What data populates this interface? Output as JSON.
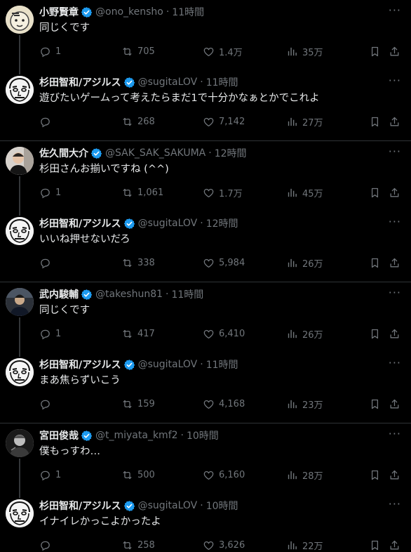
{
  "threads": [
    {
      "tweets": [
        {
          "name": "小野賢章",
          "handle": "@ono_kensho",
          "time": "11時間",
          "text": "同じくです",
          "replies": "1",
          "retweets": "705",
          "likes": "1.4万",
          "views": "35万",
          "avatar": "avatar-ono"
        },
        {
          "name": "杉田智和/アジルス",
          "handle": "@sugitaLOV",
          "time": "11時間",
          "text": "遊びたいゲームって考えたらまだ1で十分かなぁとかでこれよ",
          "replies": "",
          "retweets": "268",
          "likes": "7,142",
          "views": "27万",
          "avatar": "avatar-sugita"
        }
      ]
    },
    {
      "tweets": [
        {
          "name": "佐久間大介",
          "handle": "@SAK_SAK_SAKUMA",
          "time": "12時間",
          "text": "杉田さんお揃いですね (^^)",
          "replies": "1",
          "retweets": "1,061",
          "likes": "1.7万",
          "views": "45万",
          "avatar": "avatar-sakuma"
        },
        {
          "name": "杉田智和/アジルス",
          "handle": "@sugitaLOV",
          "time": "12時間",
          "text": "いいね押せないだろ",
          "replies": "",
          "retweets": "338",
          "likes": "5,984",
          "views": "26万",
          "avatar": "avatar-sugita"
        }
      ]
    },
    {
      "tweets": [
        {
          "name": "武内駿輔",
          "handle": "@takeshun81",
          "time": "11時間",
          "text": "同じくです",
          "replies": "1",
          "retweets": "417",
          "likes": "6,410",
          "views": "26万",
          "avatar": "avatar-takeuchi"
        },
        {
          "name": "杉田智和/アジルス",
          "handle": "@sugitaLOV",
          "time": "11時間",
          "text": "まあ焦らずいこう",
          "replies": "",
          "retweets": "159",
          "likes": "4,168",
          "views": "23万",
          "avatar": "avatar-sugita"
        }
      ]
    },
    {
      "tweets": [
        {
          "name": "宮田俊哉",
          "handle": "@t_miyata_kmf2",
          "time": "10時間",
          "text": "僕もっすわ…",
          "replies": "1",
          "retweets": "500",
          "likes": "6,160",
          "views": "28万",
          "avatar": "avatar-miyata"
        },
        {
          "name": "杉田智和/アジルス",
          "handle": "@sugitaLOV",
          "time": "10時間",
          "text": "イナイレかっこよかったよ",
          "replies": "",
          "retweets": "258",
          "likes": "3,626",
          "views": "22万",
          "avatar": "avatar-sugita"
        }
      ]
    }
  ],
  "separator": "·",
  "more_glyph": "···",
  "icons": [
    "reply-icon",
    "retweet-icon",
    "like-icon",
    "views-icon",
    "bookmark-icon",
    "share-icon",
    "verified-badge-icon",
    "more-icon"
  ],
  "colors": {
    "background": "#000000",
    "text": "#e7e9ea",
    "muted": "#71767b",
    "verified": "#1d9bf0",
    "divider": "#2f3336"
  }
}
